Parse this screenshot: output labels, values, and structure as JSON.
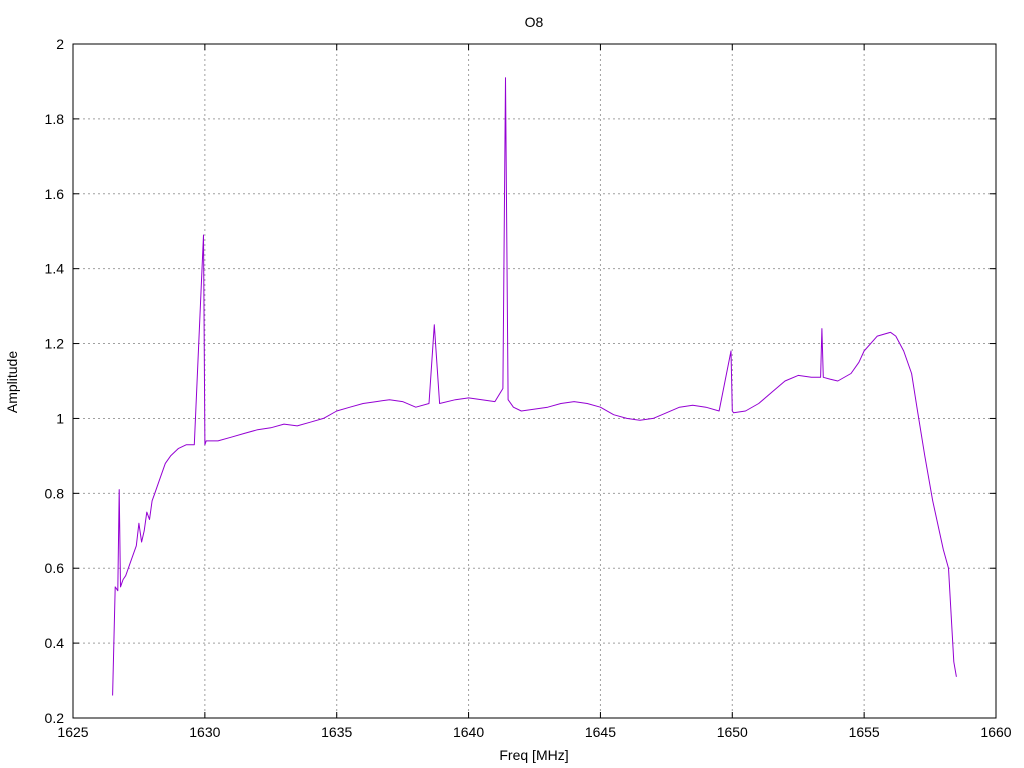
{
  "chart_data": {
    "type": "line",
    "title": "O8",
    "xlabel": "Freq [MHz]",
    "ylabel": "Amplitude",
    "xlim": [
      1625,
      1660
    ],
    "ylim": [
      0.2,
      2
    ],
    "grid": true,
    "xticks": [
      "1625",
      "1630",
      "1635",
      "1640",
      "1645",
      "1650",
      "1655",
      "1660"
    ],
    "yticks": [
      "0.2",
      "0.4",
      "0.6",
      "0.8",
      "1",
      "1.2",
      "1.4",
      "1.6",
      "1.8",
      "2"
    ],
    "line_color": "#9400d3",
    "series": [
      {
        "x": [
          1626.5,
          1626.6,
          1626.7,
          1626.75,
          1626.8,
          1626.85,
          1626.9,
          1627.0,
          1627.2,
          1627.4,
          1627.5,
          1627.6,
          1627.7,
          1627.8,
          1627.9,
          1628.0,
          1628.1,
          1628.3,
          1628.5,
          1628.7,
          1629.0,
          1629.3,
          1629.6,
          1629.95,
          1630.0,
          1630.05,
          1630.5,
          1631.0,
          1631.5,
          1632.0,
          1632.5,
          1633.0,
          1633.5,
          1634.0,
          1634.5,
          1635.0,
          1635.5,
          1636.0,
          1636.5,
          1637.0,
          1637.5,
          1638.0,
          1638.5,
          1638.7,
          1638.9,
          1639.5,
          1640.0,
          1640.5,
          1641.0,
          1641.3,
          1641.4,
          1641.5,
          1641.7,
          1642.0,
          1642.5,
          1643.0,
          1643.5,
          1644.0,
          1644.5,
          1645.0,
          1645.5,
          1646.0,
          1646.5,
          1647.0,
          1647.5,
          1648.0,
          1648.5,
          1649.0,
          1649.5,
          1649.95,
          1650.0,
          1650.05,
          1650.5,
          1651.0,
          1651.5,
          1652.0,
          1652.5,
          1653.0,
          1653.35,
          1653.4,
          1653.45,
          1653.7,
          1654.0,
          1654.5,
          1654.8,
          1655.0,
          1655.5,
          1656.0,
          1656.2,
          1656.5,
          1656.8,
          1657.0,
          1657.3,
          1657.6,
          1658.0,
          1658.2,
          1658.4,
          1658.5
        ],
        "y": [
          0.26,
          0.55,
          0.54,
          0.81,
          0.55,
          0.56,
          0.57,
          0.58,
          0.62,
          0.66,
          0.72,
          0.67,
          0.7,
          0.75,
          0.73,
          0.78,
          0.8,
          0.84,
          0.88,
          0.9,
          0.92,
          0.93,
          0.93,
          1.49,
          0.93,
          0.94,
          0.94,
          0.95,
          0.96,
          0.97,
          0.975,
          0.985,
          0.98,
          0.99,
          1.0,
          1.02,
          1.03,
          1.04,
          1.045,
          1.05,
          1.045,
          1.03,
          1.04,
          1.25,
          1.04,
          1.05,
          1.055,
          1.05,
          1.045,
          1.08,
          1.91,
          1.05,
          1.03,
          1.02,
          1.025,
          1.03,
          1.04,
          1.045,
          1.04,
          1.03,
          1.01,
          1.0,
          0.995,
          1.0,
          1.015,
          1.03,
          1.035,
          1.03,
          1.02,
          1.18,
          1.02,
          1.015,
          1.02,
          1.04,
          1.07,
          1.1,
          1.115,
          1.11,
          1.11,
          1.24,
          1.11,
          1.105,
          1.1,
          1.12,
          1.15,
          1.18,
          1.22,
          1.23,
          1.22,
          1.18,
          1.12,
          1.03,
          0.9,
          0.78,
          0.65,
          0.6,
          0.35,
          0.31
        ]
      }
    ]
  }
}
